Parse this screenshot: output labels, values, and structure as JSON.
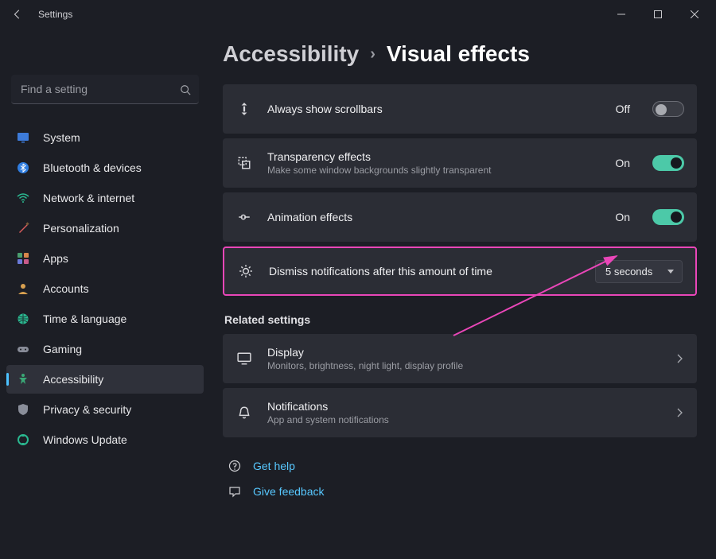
{
  "titlebar": {
    "app": "Settings"
  },
  "search": {
    "placeholder": "Find a setting"
  },
  "sidebar": {
    "items": [
      {
        "label": "System"
      },
      {
        "label": "Bluetooth & devices"
      },
      {
        "label": "Network & internet"
      },
      {
        "label": "Personalization"
      },
      {
        "label": "Apps"
      },
      {
        "label": "Accounts"
      },
      {
        "label": "Time & language"
      },
      {
        "label": "Gaming"
      },
      {
        "label": "Accessibility"
      },
      {
        "label": "Privacy & security"
      },
      {
        "label": "Windows Update"
      }
    ]
  },
  "breadcrumb": {
    "parent": "Accessibility",
    "current": "Visual effects"
  },
  "cards": {
    "scrollbars": {
      "title": "Always show scrollbars",
      "state": "Off"
    },
    "transparency": {
      "title": "Transparency effects",
      "sub": "Make some window backgrounds slightly transparent",
      "state": "On"
    },
    "animation": {
      "title": "Animation effects",
      "state": "On"
    },
    "dismiss": {
      "title": "Dismiss notifications after this amount of time",
      "value": "5 seconds"
    }
  },
  "related": {
    "heading": "Related settings",
    "display": {
      "title": "Display",
      "sub": "Monitors, brightness, night light, display profile"
    },
    "notifications": {
      "title": "Notifications",
      "sub": "App and system notifications"
    }
  },
  "links": {
    "help": "Get help",
    "feedback": "Give feedback"
  }
}
